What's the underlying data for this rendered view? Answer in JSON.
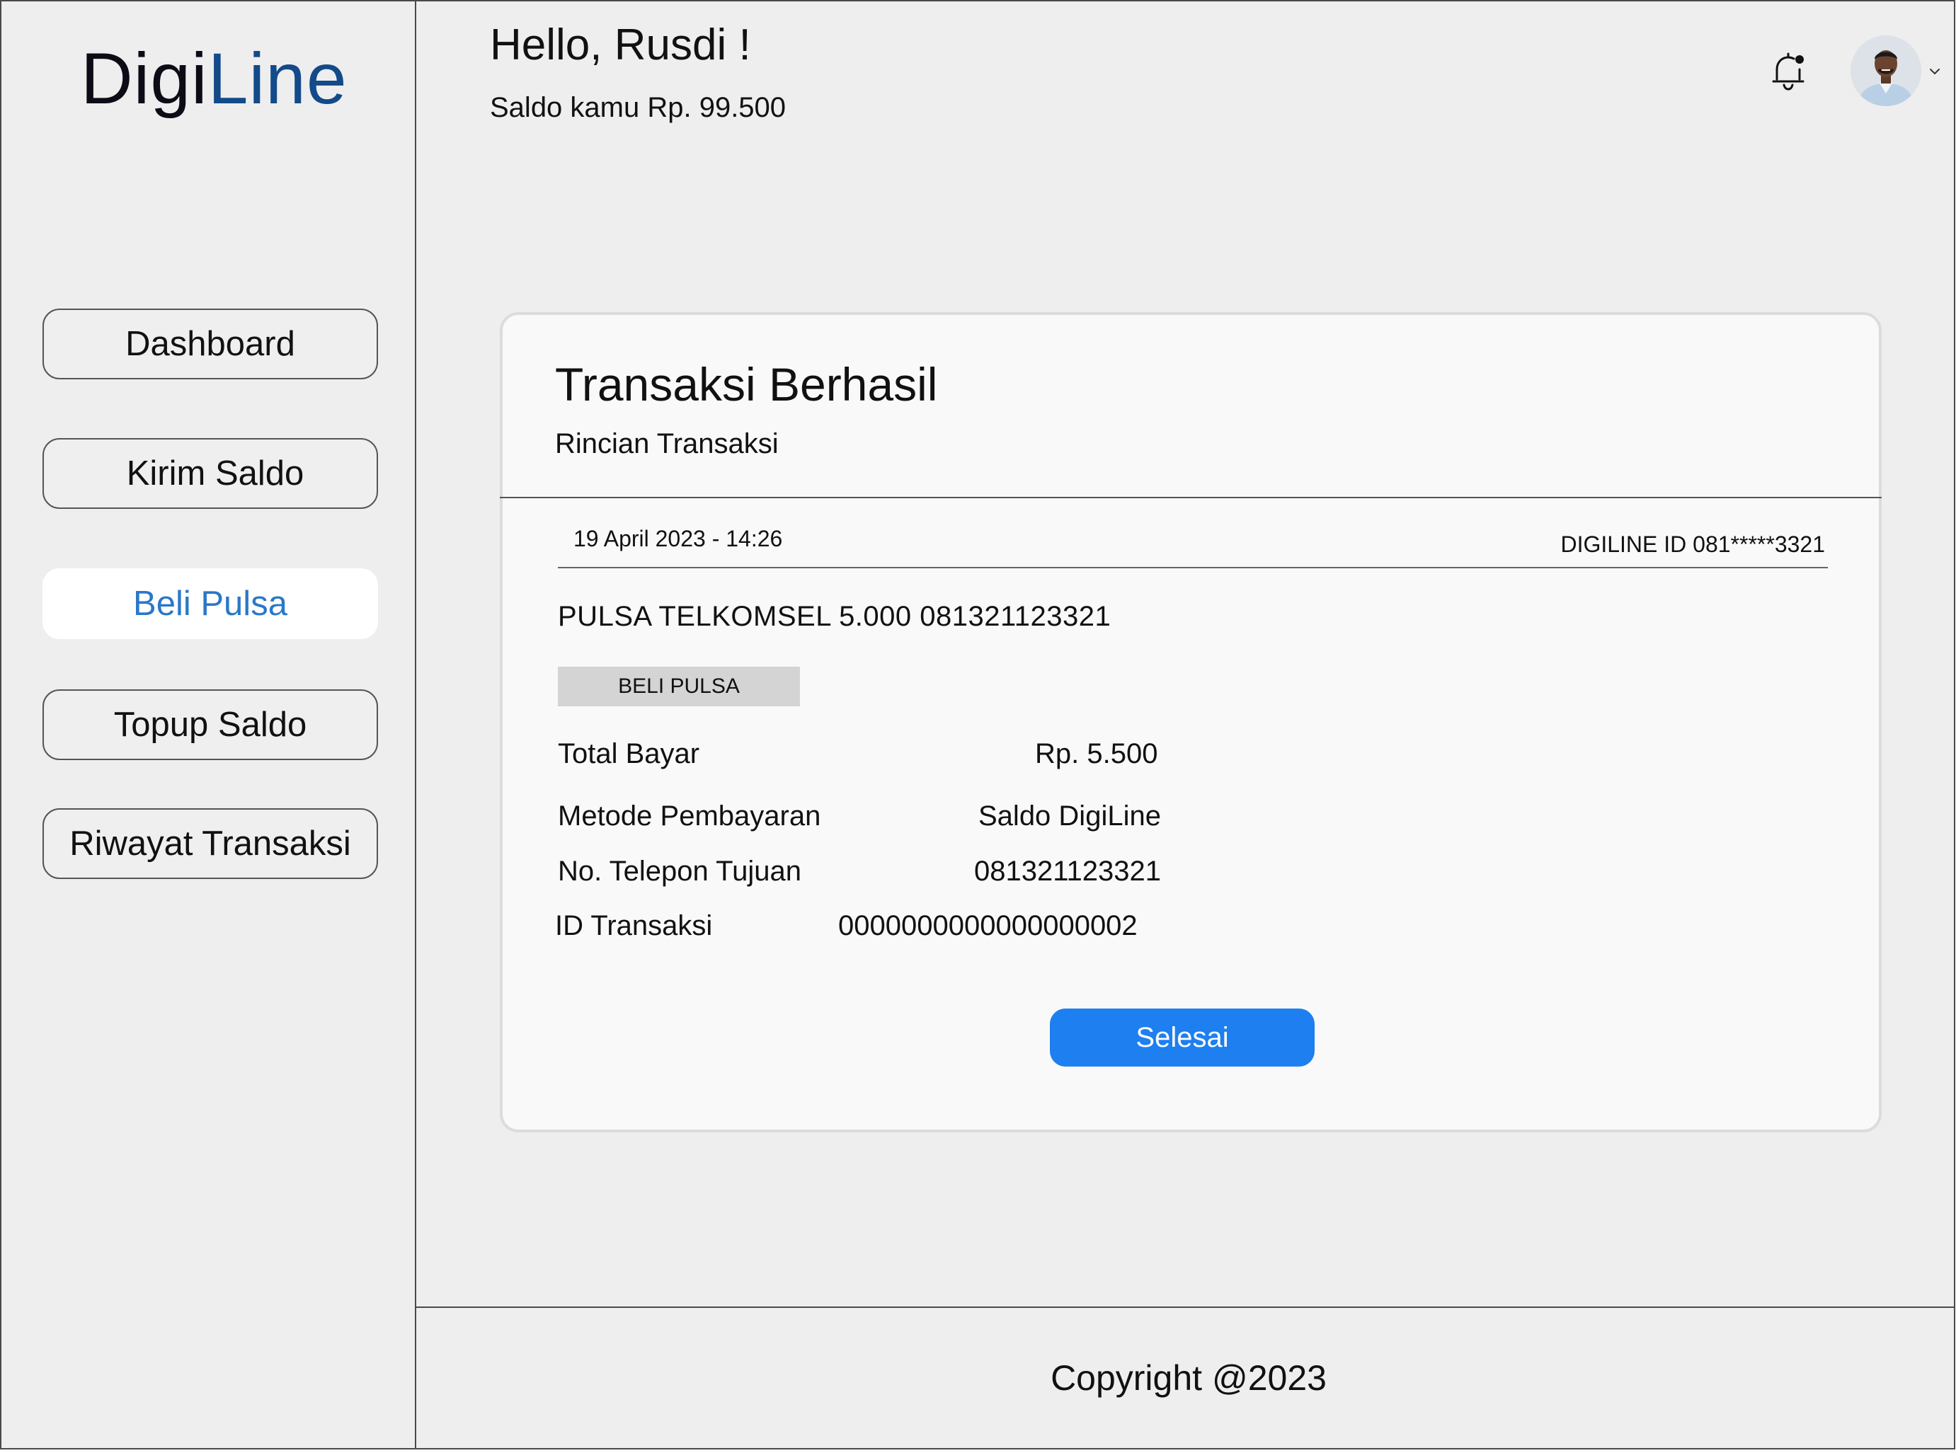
{
  "app": {
    "logo_part1": "Digi",
    "logo_part2": "Line",
    "brand_color": "#124a8a"
  },
  "header": {
    "greeting": "Hello, Rusdi !",
    "saldo": "Saldo kamu Rp. 99.500",
    "notification_icon": "bell-icon",
    "avatar_icon": "user-avatar",
    "dropdown_icon": "chevron-down-icon"
  },
  "sidebar": {
    "items": [
      {
        "label": "Dashboard",
        "active": false
      },
      {
        "label": "Kirim Saldo",
        "active": false
      },
      {
        "label": "Beli Pulsa",
        "active": true
      },
      {
        "label": "Topup Saldo",
        "active": false
      },
      {
        "label": "Riwayat Transaksi",
        "active": false
      }
    ],
    "active_color": "#2a78c8"
  },
  "receipt": {
    "title": "Transaksi Berhasil",
    "subtitle": "Rincian Transaksi",
    "datetime": "19 April 2023 - 14:26",
    "digiline_id": "DIGILINE ID 081*****3321",
    "product": "PULSA TELKOMSEL 5.000 081321123321",
    "tag": "BELI PULSA",
    "rows": [
      {
        "label": "Total Bayar",
        "value": "Rp. 5.500"
      },
      {
        "label": "Metode Pembayaran",
        "value": "Saldo DigiLine"
      },
      {
        "label": "No. Telepon Tujuan",
        "value": "081321123321"
      },
      {
        "label": "ID Transaksi",
        "value": "0000000000000000002"
      }
    ],
    "button_label": "Selesai",
    "button_color": "#1d7ff0"
  },
  "footer": {
    "copyright": "Copyright @2023"
  }
}
